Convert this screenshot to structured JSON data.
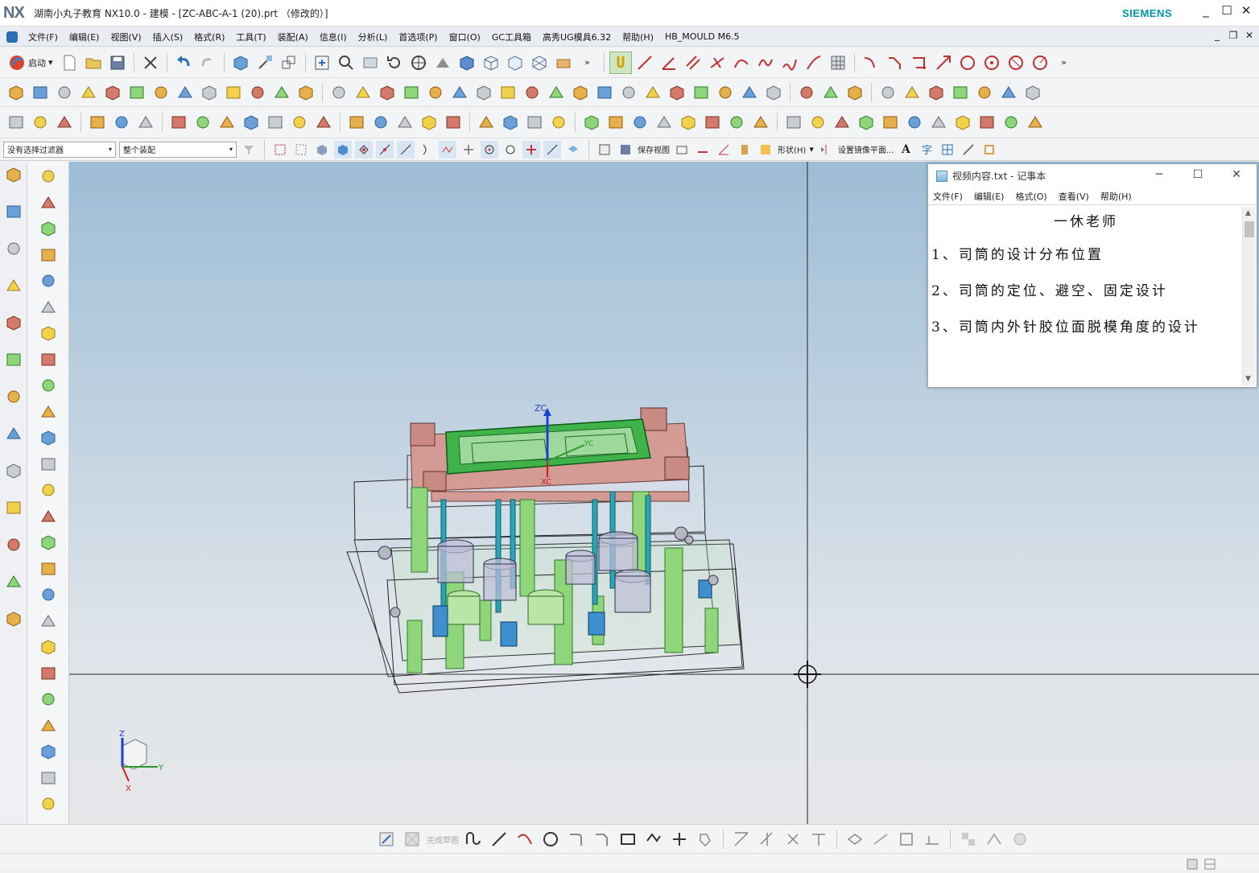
{
  "window": {
    "logo": "NX",
    "title": "湖南小丸子教育 NX10.0 - 建模 - [ZC-ABC-A-1 (20).prt （修改的）]",
    "brand": "SIEMENS",
    "controls": {
      "minimize": "_",
      "maximize": "☐",
      "close": "✕"
    }
  },
  "menubar": {
    "items": [
      "文件(F)",
      "编辑(E)",
      "视图(V)",
      "插入(S)",
      "格式(R)",
      "工具(T)",
      "装配(A)",
      "信息(I)",
      "分析(L)",
      "首选项(P)",
      "窗口(O)",
      "GC工具箱",
      "高秀UG模具6.32",
      "帮助(H)",
      "HB_MOULD M6.5"
    ],
    "controls": {
      "minimize": "_",
      "restore": "❐",
      "close": "✕"
    }
  },
  "toolbar": {
    "start_label": "启动",
    "more_glyph": "»"
  },
  "filter_bar": {
    "selection_filter": "没有选择过滤器",
    "scope": "整个装配",
    "save_view_label": "保存视图",
    "shape_label": "形状(H)",
    "mirror_label": "设置镜像平面...",
    "dropdown_glyph": "▾"
  },
  "viewport": {
    "triad": {
      "x": "X",
      "y": "Y",
      "z": "Z"
    },
    "wcs": {
      "zc": "ZC",
      "yc": "YC",
      "xc": "XC"
    }
  },
  "bottom_toolbar": {
    "finish_sketch_label": "完成草图"
  },
  "notepad": {
    "title": "视频内容.txt - 记事本",
    "menu": [
      "文件(F)",
      "编辑(E)",
      "格式(O)",
      "查看(V)",
      "帮助(H)"
    ],
    "heading": "一休老师",
    "lines": [
      "1、司筒的设计分布位置",
      "2、司筒的定位、避空、固定设计",
      "3、司筒内外针胶位面脱模角度的设计"
    ],
    "controls": {
      "minimize": "─",
      "maximize": "☐",
      "close": "✕"
    }
  },
  "colors": {
    "accent": "#0096a8",
    "viewport_top": "#9dbdd6",
    "viewport_bottom": "#e6e7e9",
    "mold_plate": "#d49a94",
    "cavity_green": "#3fb24a",
    "pins_green": "#8fd57a",
    "pins_cyan": "#2aa5b5"
  }
}
